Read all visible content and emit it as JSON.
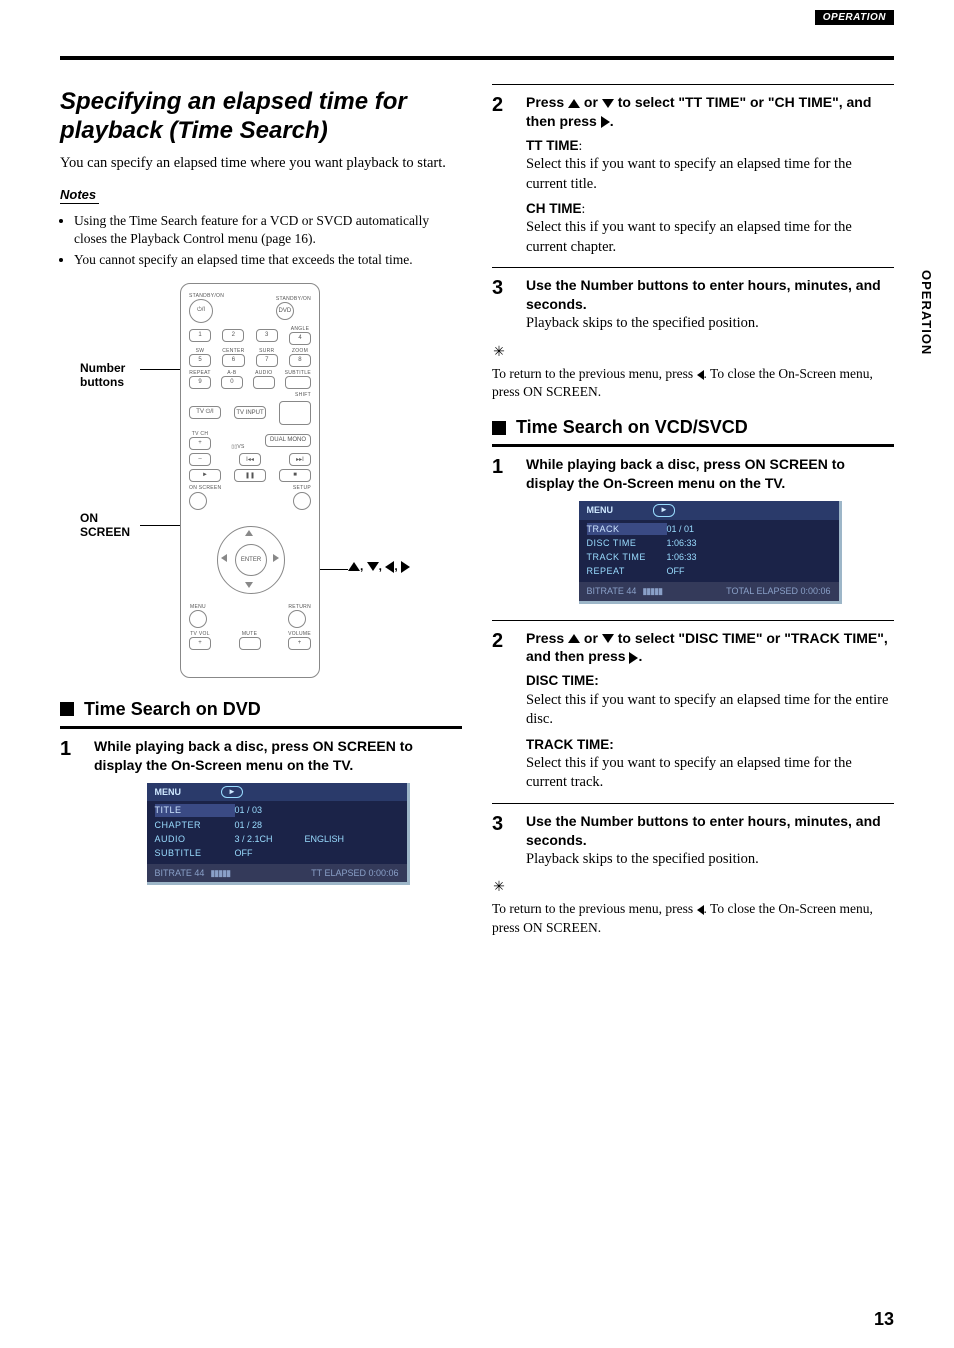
{
  "header": {
    "section": "OPERATION"
  },
  "side": {
    "label": "OPERATION"
  },
  "page_number": "13",
  "left": {
    "title": "Specifying an elapsed time for playback (Time Search)",
    "intro": "You can specify an elapsed time where you want playback to start.",
    "notes_label": "Notes",
    "notes": [
      "Using the Time Search feature for a VCD or SVCD automatically closes the Playback Control menu (page 16).",
      "You cannot specify an elapsed time that exceeds the total time."
    ],
    "remote": {
      "callout_number": "Number buttons",
      "callout_onscreen": "ON SCREEN",
      "arrow_seq_sep": ", ",
      "labels": {
        "standby_on_l": "STANDBY/ON",
        "standby_on_r": "STANDBY/ON",
        "dvd": "DVD",
        "angle": "ANGLE",
        "sw": "SW",
        "center": "CENTER",
        "surr": "SURR",
        "zoom": "ZOOM",
        "repeat": "REPEAT",
        "ab": "A-B",
        "audio": "AUDIO",
        "subtitle": "SUBTITLE",
        "shift": "SHIFT",
        "tv_power": "TV ⏻/I",
        "tv_input": "TV INPUT",
        "tv_ch": "TV CH",
        "dvs": "▯▯VS",
        "dual_mono": "DUAL MONO",
        "on_screen": "ON SCREEN",
        "setup": "SETUP",
        "enter": "ENTER",
        "menu": "MENU",
        "return": "RETURN",
        "tv_vol": "TV VOL",
        "mute": "MUTE",
        "volume": "VOLUME"
      },
      "numbers": [
        "1",
        "2",
        "3",
        "4",
        "5",
        "6",
        "7",
        "8",
        "9",
        "0"
      ]
    },
    "sub_heading": "Time Search on DVD",
    "step1": {
      "num": "1",
      "title": "While playing back a disc, press ON SCREEN to display the On-Screen menu on the TV."
    },
    "osd_dvd": {
      "menu": "MENU",
      "rows": [
        {
          "k": "TITLE",
          "v1": "01 / 03",
          "v2": "",
          "sel": true
        },
        {
          "k": "CHAPTER",
          "v1": "01 / 28",
          "v2": ""
        },
        {
          "k": "AUDIO",
          "v1": "3 / 2.1CH",
          "v2": "ENGLISH"
        },
        {
          "k": "SUBTITLE",
          "v1": "OFF",
          "v2": ""
        }
      ],
      "footer_left": "BITRATE  44",
      "footer_right": "TT  ELAPSED   0:00:06"
    }
  },
  "right": {
    "step2": {
      "num": "2",
      "line1a": "Press ",
      "line1b": " or ",
      "line1c": " to select \"TT TIME\" or \"CH TIME\", and then press ",
      "line1d": ".",
      "tt_label": "TT TIME",
      "tt_colon": ":",
      "tt_body": "Select this if you want to specify an elapsed time for the current title.",
      "ch_label": "CH TIME",
      "ch_colon": ":",
      "ch_body": "Select this if you want to specify an elapsed time for the current chapter."
    },
    "step3": {
      "num": "3",
      "title": "Use the Number buttons to enter hours, minutes, and seconds.",
      "body": "Playback skips to the specified position."
    },
    "tip_a": "To return to the previous menu, press ",
    "tip_b": ". To close the On-Screen menu, press ON SCREEN.",
    "sub_heading": "Time Search on VCD/SVCD",
    "vcd_step1": {
      "num": "1",
      "title": "While playing back a disc, press ON SCREEN to display the On-Screen menu on the TV."
    },
    "osd_vcd": {
      "menu": "MENU",
      "rows": [
        {
          "k": "TRACK",
          "v1": "01 / 01",
          "sel": true
        },
        {
          "k": "DISC  TIME",
          "v1": "1:06:33"
        },
        {
          "k": "TRACK  TIME",
          "v1": "1:06:33"
        },
        {
          "k": "REPEAT",
          "v1": "OFF"
        }
      ],
      "footer_left": "BITRATE  44",
      "footer_right": "TOTAL  ELAPSED   0:00:06"
    },
    "vcd_step2": {
      "num": "2",
      "line1a": "Press ",
      "line1b": " or ",
      "line1c": " to select \"DISC TIME\" or \"TRACK TIME\", and then press ",
      "line1d": ".",
      "disc_label": "DISC TIME:",
      "disc_body": "Select this if you want to specify an elapsed time for the entire disc.",
      "track_label": "TRACK TIME:",
      "track_body": "Select this if you want to specify an elapsed time for the current track."
    },
    "vcd_step3": {
      "num": "3",
      "title": "Use the Number buttons to enter hours, minutes, and seconds.",
      "body": "Playback skips to the specified position."
    }
  }
}
